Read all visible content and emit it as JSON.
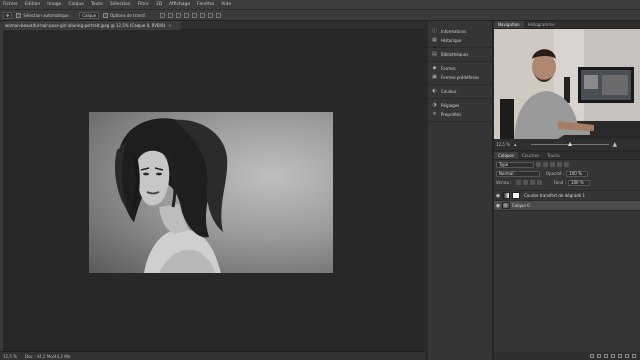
{
  "menubar": {
    "items": [
      "Fichier",
      "Edition",
      "Image",
      "Calque",
      "Texte",
      "Sélection",
      "Filtre",
      "3D",
      "Affichage",
      "Fenêtre",
      "Aide"
    ]
  },
  "options_bar": {
    "auto_select_label": "Sélection automatique :",
    "auto_select_value": "Calque",
    "transform_label": "Options de transf."
  },
  "document": {
    "tab_title": "woman-beautiful-hair-pose-girl-alluring-portrait.jpeg @ 12,5% (Calque 0, RVB/8)",
    "close_glyph": "×"
  },
  "status_bar": {
    "zoom": "12,5 %",
    "doc_info": "Doc : 44,2 Mo/44,2 Mo"
  },
  "panel_list": {
    "groups": [
      [
        "Informations",
        "Historique"
      ],
      [
        "Bibliothèques"
      ],
      [
        "Formes",
        "Formes prédéfinies"
      ],
      [
        "Couleur"
      ],
      [
        "Réglages",
        "Propriétés"
      ]
    ]
  },
  "navigator": {
    "tabs": [
      "Navigation",
      "Histogramme"
    ],
    "zoom": "12,5 %",
    "zoom_level": 0.5
  },
  "layers": {
    "tabs": [
      "Calques",
      "Couches",
      "Tracés"
    ],
    "filter_kind": "Type",
    "blend_mode": "Normal",
    "opacity_label": "Opacité :",
    "opacity": "100 %",
    "lock_label": "Verrou :",
    "fill_label": "Fond :",
    "fill": "100 %",
    "items": [
      {
        "name": "Courbe transfert de dégradé 1",
        "selected": false
      },
      {
        "name": "Calque 0",
        "selected": true
      }
    ]
  }
}
